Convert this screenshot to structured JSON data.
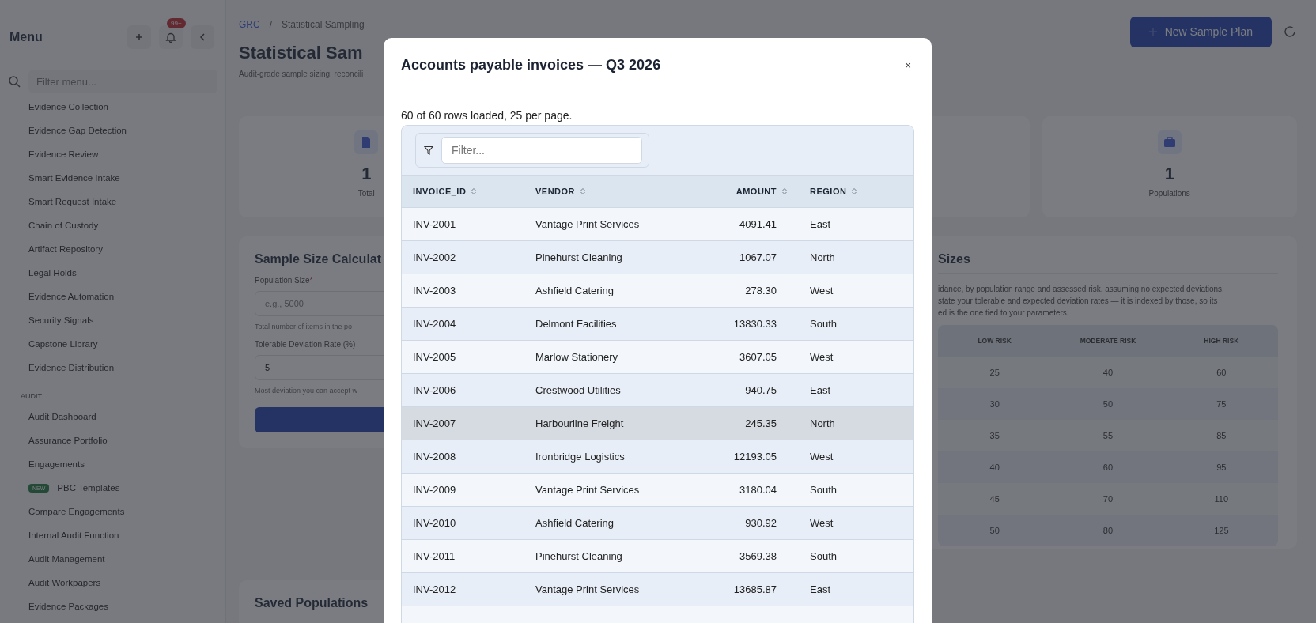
{
  "sidebar": {
    "title": "Menu",
    "notification_badge": "99+",
    "filter": {
      "placeholder": "Filter menu..."
    },
    "sections": [
      {
        "items": [
          {
            "label": "Evidence Collection"
          },
          {
            "label": "Evidence Gap Detection"
          },
          {
            "label": "Evidence Review"
          },
          {
            "label": "Smart Evidence Intake"
          },
          {
            "label": "Smart Request Intake"
          },
          {
            "label": "Chain of Custody"
          },
          {
            "label": "Artifact Repository"
          },
          {
            "label": "Legal Holds"
          },
          {
            "label": "Evidence Automation"
          },
          {
            "label": "Security Signals"
          },
          {
            "label": "Capstone Library"
          },
          {
            "label": "Evidence Distribution"
          }
        ]
      },
      {
        "heading": "AUDIT",
        "items": [
          {
            "label": "Audit Dashboard"
          },
          {
            "label": "Assurance Portfolio"
          },
          {
            "label": "Engagements"
          },
          {
            "label": "PBC Templates",
            "badge": "NEW"
          },
          {
            "label": "Compare Engagements"
          },
          {
            "label": "Internal Audit Function"
          },
          {
            "label": "Audit Management"
          },
          {
            "label": "Audit Workpapers"
          },
          {
            "label": "Evidence Packages"
          }
        ]
      }
    ]
  },
  "breadcrumb": {
    "items": [
      "GRC",
      "Statistical Sampling"
    ],
    "separator": "/"
  },
  "page": {
    "title": "Statistical Sam",
    "subtitle": "Audit-grade sample sizing, reconcili",
    "primary_action": "New Sample Plan"
  },
  "stats": [
    {
      "value": "1",
      "label": "Total"
    },
    {
      "value": "1",
      "label": "Populations"
    }
  ],
  "calculator": {
    "title": "Sample Size Calculat",
    "fields": [
      {
        "label": "Population Size",
        "required_mark": "*",
        "placeholder": "e.g., 5000",
        "help": "Total number of items in the po"
      },
      {
        "label": "Tolerable Deviation Rate (%)",
        "value": "5",
        "help": "Most deviation you can accept w"
      }
    ]
  },
  "reference": {
    "title": "Sizes",
    "text": [
      "idance, by population range and assessed risk, assuming no expected deviations.",
      "state your tolerable and expected deviation rates — it is indexed by those, so its",
      "ed is the one tied to your parameters."
    ],
    "columns": [
      "LOW RISK",
      "MODERATE RISK",
      "HIGH RISK"
    ],
    "rows": [
      [
        "25",
        "40",
        "60"
      ],
      [
        "30",
        "50",
        "75"
      ],
      [
        "35",
        "55",
        "85"
      ],
      [
        "40",
        "60",
        "95"
      ],
      [
        "45",
        "70",
        "110"
      ],
      [
        "50",
        "80",
        "125"
      ]
    ]
  },
  "saved_populations": {
    "title": "Saved Populations"
  },
  "modal": {
    "title": "Accounts payable invoices — Q3 2026",
    "close": "×",
    "summary": "60 of 60 rows loaded, 25 per page.",
    "filter": {
      "placeholder": "Filter..."
    },
    "columns": [
      {
        "label": "INVOICE_ID"
      },
      {
        "label": "VENDOR"
      },
      {
        "label": "AMOUNT"
      },
      {
        "label": "REGION"
      }
    ],
    "rows": [
      {
        "cells": [
          "INV-2001",
          "Vantage Print Services",
          "4091.41",
          "East"
        ],
        "highlighted": false
      },
      {
        "cells": [
          "INV-2002",
          "Pinehurst Cleaning",
          "1067.07",
          "North"
        ],
        "highlighted": false
      },
      {
        "cells": [
          "INV-2003",
          "Ashfield Catering",
          "278.30",
          "West"
        ],
        "highlighted": false
      },
      {
        "cells": [
          "INV-2004",
          "Delmont Facilities",
          "13830.33",
          "South"
        ],
        "highlighted": false
      },
      {
        "cells": [
          "INV-2005",
          "Marlow Stationery",
          "3607.05",
          "West"
        ],
        "highlighted": false
      },
      {
        "cells": [
          "INV-2006",
          "Crestwood Utilities",
          "940.75",
          "East"
        ],
        "highlighted": false
      },
      {
        "cells": [
          "INV-2007",
          "Harbourline Freight",
          "245.35",
          "North"
        ],
        "highlighted": true
      },
      {
        "cells": [
          "INV-2008",
          "Ironbridge Logistics",
          "12193.05",
          "West"
        ],
        "highlighted": false
      },
      {
        "cells": [
          "INV-2009",
          "Vantage Print Services",
          "3180.04",
          "South"
        ],
        "highlighted": false
      },
      {
        "cells": [
          "INV-2010",
          "Ashfield Catering",
          "930.92",
          "West"
        ],
        "highlighted": false
      },
      {
        "cells": [
          "INV-2011",
          "Pinehurst Cleaning",
          "3569.38",
          "South"
        ],
        "highlighted": false
      },
      {
        "cells": [
          "INV-2012",
          "Vantage Print Services",
          "13685.87",
          "East"
        ],
        "highlighted": false
      }
    ]
  }
}
